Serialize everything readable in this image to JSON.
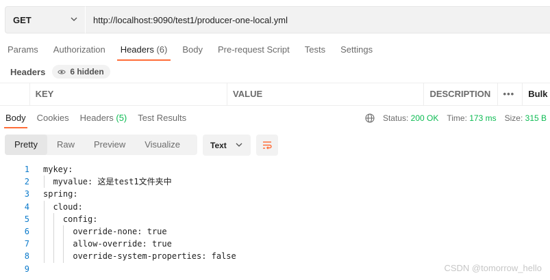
{
  "request": {
    "method": "GET",
    "url": "http://localhost:9090/test1/producer-one-local.yml"
  },
  "request_tabs": [
    {
      "label": "Params"
    },
    {
      "label": "Authorization"
    },
    {
      "label": "Headers",
      "count": "(6)"
    },
    {
      "label": "Body"
    },
    {
      "label": "Pre-request Script"
    },
    {
      "label": "Tests"
    },
    {
      "label": "Settings"
    }
  ],
  "headers_section": {
    "title": "Headers",
    "hidden_label": "6 hidden"
  },
  "table": {
    "columns": [
      "KEY",
      "VALUE",
      "DESCRIPTION",
      "•••",
      "Bulk"
    ]
  },
  "response_tabs": [
    {
      "label": "Body"
    },
    {
      "label": "Cookies"
    },
    {
      "label": "Headers",
      "count": "(5)"
    },
    {
      "label": "Test Results"
    }
  ],
  "status": {
    "status_label": "Status:",
    "status_value": "200 OK",
    "time_label": "Time:",
    "time_value": "173 ms",
    "size_label": "Size:",
    "size_value": "315 B"
  },
  "format_buttons": [
    "Pretty",
    "Raw",
    "Preview",
    "Visualize"
  ],
  "text_select": "Text",
  "code_lines": [
    {
      "n": "1",
      "text": "mykey:"
    },
    {
      "n": "2",
      "text": "  myvalue: 这是test1文件夹中"
    },
    {
      "n": "3",
      "text": "spring:"
    },
    {
      "n": "4",
      "text": "  cloud:"
    },
    {
      "n": "5",
      "text": "    config:"
    },
    {
      "n": "6",
      "text": "      override-none: true"
    },
    {
      "n": "7",
      "text": "      allow-override: true"
    },
    {
      "n": "8",
      "text": "      override-system-properties: false"
    },
    {
      "n": "9",
      "text": ""
    }
  ],
  "watermark": "CSDN @tomorrow_hello",
  "colors": {
    "accent": "#ff6c37",
    "success": "#0cbb52",
    "line_number": "#0b7acb"
  }
}
